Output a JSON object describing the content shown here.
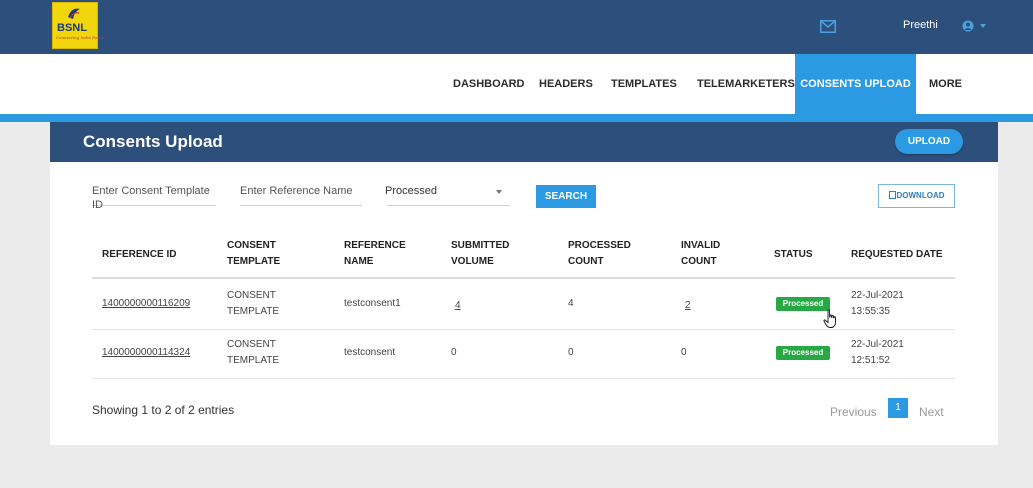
{
  "brand": {
    "logo_text": "BSNL",
    "tagline": "Connecting India Faster"
  },
  "header": {
    "user_name": "Preethi"
  },
  "nav": {
    "items": [
      "DASHBOARD",
      "HEADERS",
      "TEMPLATES",
      "TELEMARKETERS",
      "CONSENTS UPLOAD",
      "MORE"
    ],
    "active": "CONSENTS UPLOAD"
  },
  "page": {
    "title": "Consents Upload",
    "upload_label": "UPLOAD"
  },
  "filters": {
    "template_id_placeholder": "Enter Consent Template ID",
    "reference_name_placeholder": "Enter Reference Name",
    "status_selected": "Processed",
    "search_label": "SEARCH",
    "download_label": "DOWNLOAD"
  },
  "table": {
    "headers": {
      "reference_id": "REFERENCE ID",
      "consent_template": [
        "CONSENT",
        "TEMPLATE"
      ],
      "reference_name": [
        "REFERENCE",
        "NAME"
      ],
      "submitted_volume": [
        "SUBMITTED",
        "VOLUME"
      ],
      "processed_count": [
        "PROCESSED",
        "COUNT"
      ],
      "invalid_count": [
        "INVALID",
        "COUNT"
      ],
      "status": "STATUS",
      "requested_date": "REQUESTED DATE"
    },
    "rows": [
      {
        "reference_id": "1400000000116209",
        "consent_template": [
          "CONSENT",
          "TEMPLATE"
        ],
        "reference_name": "testconsent1",
        "submitted_volume": "4",
        "processed_count": "4",
        "invalid_count": "2",
        "status": "Processed",
        "requested_date": [
          "22-Jul-2021",
          "13:55:35"
        ]
      },
      {
        "reference_id": "1400000000114324",
        "consent_template": [
          "CONSENT",
          "TEMPLATE"
        ],
        "reference_name": "testconsent",
        "submitted_volume": "0",
        "processed_count": "0",
        "invalid_count": "0",
        "status": "Processed",
        "requested_date": [
          "22-Jul-2021",
          "12:51:52"
        ]
      }
    ]
  },
  "pagination": {
    "summary": "Showing 1 to 2 of 2 entries",
    "previous_label": "Previous",
    "current_page": "1",
    "next_label": "Next"
  },
  "colors": {
    "primary_dark": "#2c4f7c",
    "accent_blue": "#2b9ae2",
    "status_green": "#27a845",
    "logo_yellow": "#f2d60d"
  },
  "icons": [
    "mail-icon",
    "user-icon",
    "download-icon",
    "hand-cursor-icon",
    "chevron-down-icon"
  ]
}
